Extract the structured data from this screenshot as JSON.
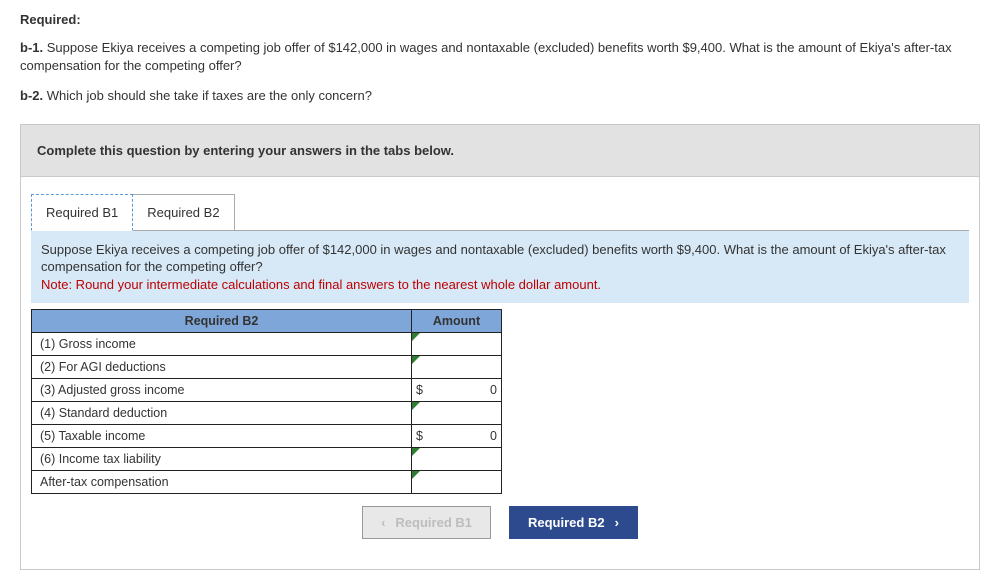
{
  "header": {
    "required_label": "Required:"
  },
  "questions": {
    "b1_label": "b-1.",
    "b1_text": "Suppose Ekiya receives a competing job offer of $142,000 in wages and nontaxable (excluded) benefits worth $9,400. What is the amount of Ekiya's after-tax compensation for the competing offer?",
    "b2_label": "b-2.",
    "b2_text": "Which job should she take if taxes are the only concern?"
  },
  "instruction": "Complete this question by entering your answers in the tabs below.",
  "tabs": {
    "b1": "Required B1",
    "b2": "Required B2"
  },
  "panel": {
    "prompt": "Suppose Ekiya receives a competing job offer of $142,000 in wages and nontaxable (excluded) benefits worth $9,400. What is the amount of Ekiya's after-tax compensation for the competing offer?",
    "note": "Note: Round your intermediate calculations and final answers to the nearest whole dollar amount."
  },
  "table": {
    "col_label": "Required B2",
    "col_amount": "Amount",
    "rows": [
      {
        "label": "(1) Gross income",
        "currency": "",
        "value": ""
      },
      {
        "label": "(2) For AGI deductions",
        "currency": "",
        "value": ""
      },
      {
        "label": "(3) Adjusted gross income",
        "currency": "$",
        "value": "0"
      },
      {
        "label": "(4) Standard deduction",
        "currency": "",
        "value": ""
      },
      {
        "label": "(5) Taxable income",
        "currency": "$",
        "value": "0"
      },
      {
        "label": "(6) Income tax liability",
        "currency": "",
        "value": ""
      },
      {
        "label": "After-tax compensation",
        "currency": "",
        "value": ""
      }
    ]
  },
  "nav": {
    "prev": "Required B1",
    "next": "Required B2"
  }
}
